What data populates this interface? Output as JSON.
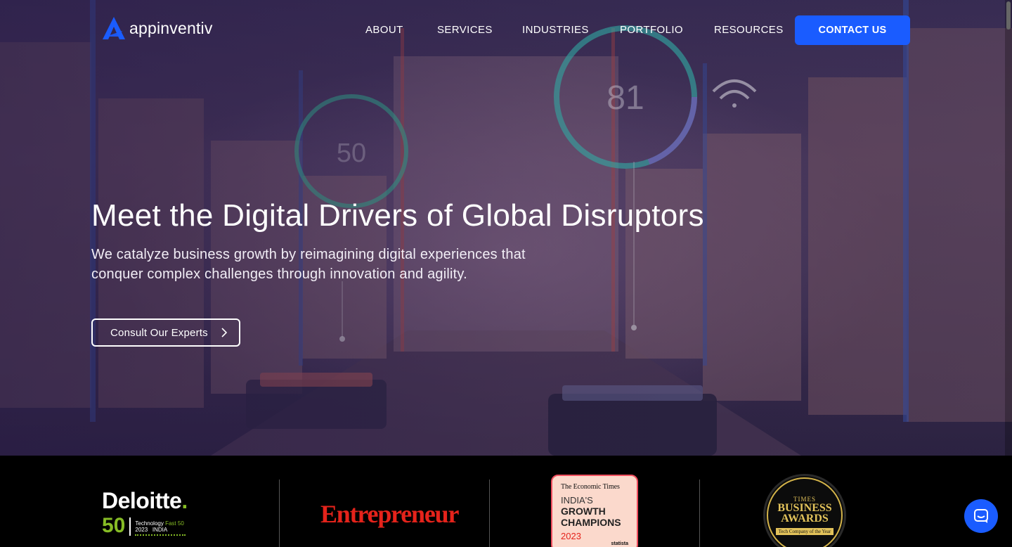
{
  "brand": {
    "name": "appinventiv",
    "accent": "#1a5cff"
  },
  "nav": {
    "items": [
      {
        "id": "about",
        "label": "ABOUT"
      },
      {
        "id": "services",
        "label": "SERVICES"
      },
      {
        "id": "industries",
        "label": "INDUSTRIES"
      },
      {
        "id": "portfolio",
        "label": "PORTFOLIO"
      },
      {
        "id": "resources",
        "label": "RESOURCES"
      }
    ],
    "contact_label": "CONTACT US"
  },
  "hero": {
    "title": "Meet the Digital Drivers of Global Disruptors",
    "subtitle": "We catalyze business growth by reimagining digital experiences that conquer complex challenges through innovation and agility.",
    "cta_label": "Consult Our Experts",
    "hud_left_value": "50",
    "hud_right_value": "81"
  },
  "awards": {
    "deloitte": {
      "name": "Deloitte",
      "dot": ".",
      "number": "50",
      "meta_1": "Technology",
      "meta_fast": "Fast 50",
      "meta_2": "2023",
      "meta_3": "INDIA"
    },
    "entrepreneur": {
      "name": "Entrepreneur"
    },
    "economic_times": {
      "top": "The Economic Times",
      "line1": "INDIA'S",
      "line2": "GROWTH",
      "line3": "CHAMPIONS",
      "year": "2023",
      "source": "statista"
    },
    "times_business": {
      "l1": "TIMES",
      "l2": "BUSINESS",
      "l3": "AWARDS",
      "caption": "Tech Company of the Year"
    }
  },
  "icons": {
    "chat": "chat-bubble-icon",
    "cta": "chevron-right-icon"
  }
}
